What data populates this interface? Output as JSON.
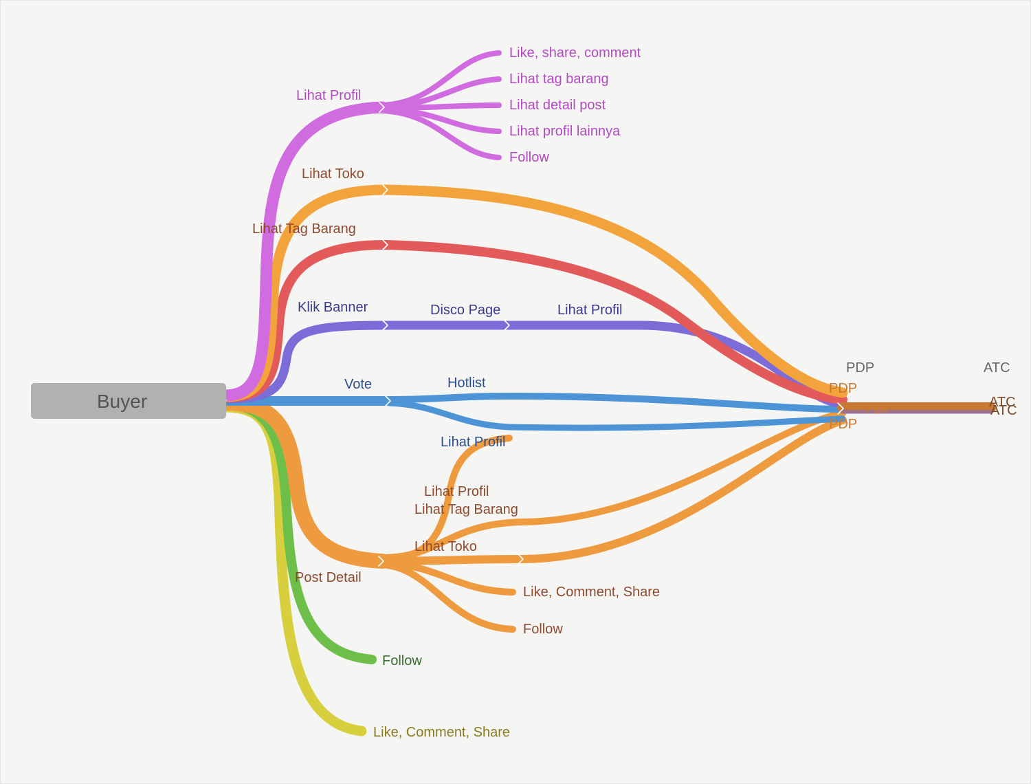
{
  "chart_data": {
    "type": "sankey-style-flow-tree",
    "root": {
      "label": "Buyer"
    },
    "branches": [
      {
        "id": "lihat-profil",
        "label": "Lihat Profil",
        "color": "#d06be0",
        "children": [
          {
            "id": "lp-like",
            "label": "Like, share, comment"
          },
          {
            "id": "lp-tag",
            "label": "Lihat tag barang"
          },
          {
            "id": "lp-det",
            "label": "Lihat detail post"
          },
          {
            "id": "lp-prof",
            "label": "Lihat profil lainnya"
          },
          {
            "id": "lp-fol",
            "label": "Follow"
          }
        ]
      },
      {
        "id": "lihat-toko",
        "label": "Lihat Toko",
        "color": "#f2a33b",
        "to": {
          "id": "pdp",
          "label": "PDP"
        }
      },
      {
        "id": "lihat-tag-barang",
        "label": "Lihat Tag Barang",
        "color": "#e35a5a",
        "to": {
          "id": "pdp",
          "label": "PDP"
        }
      },
      {
        "id": "klik-banner",
        "label": "Klik Banner",
        "color": "#7c6cd8",
        "path": [
          {
            "id": "disco",
            "label": "Disco Page"
          },
          {
            "id": "kb-lp",
            "label": "Lihat Profil"
          }
        ],
        "to": {
          "id": "pdp",
          "label": "PDP"
        }
      },
      {
        "id": "vote",
        "label": "Vote",
        "color": "#4d94d6",
        "paths": [
          [
            {
              "id": "hotlist",
              "label": "Hotlist"
            },
            {
              "id": "pdp",
              "label": "PDP"
            }
          ],
          [
            {
              "id": "vote-lp",
              "label": "Lihat Profil"
            },
            {
              "id": "pdp",
              "label": "PDP"
            }
          ]
        ]
      },
      {
        "id": "post-detail",
        "label": "Post Detail",
        "color": "#ee9a3f",
        "children": [
          {
            "id": "pd-lp",
            "label": "Lihat Profil"
          },
          {
            "id": "pd-tag",
            "label": "Lihat Tag Barang",
            "to": {
              "id": "pdp",
              "label": "PDP"
            }
          },
          {
            "id": "pd-toko",
            "label": "Lihat Toko",
            "to": {
              "id": "pdp",
              "label": "PDP"
            }
          },
          {
            "id": "pd-like",
            "label": "Like, Comment, Share"
          },
          {
            "id": "pd-fol",
            "label": "Follow"
          }
        ]
      },
      {
        "id": "follow",
        "label": "Follow",
        "color": "#6dbf4a"
      },
      {
        "id": "lcs",
        "label": "Like, Comment, Share",
        "color": "#d7cf3d"
      }
    ],
    "sinks": [
      {
        "id": "pdp",
        "label": "PDP",
        "color": "#c77934"
      },
      {
        "id": "atc",
        "label": "ATC",
        "color": "#7a4a2a"
      }
    ],
    "pdp_to_atc": true
  },
  "labels": {
    "root": "Buyer",
    "lihat_profil": "Lihat Profil",
    "lp_like": "Like, share, comment",
    "lp_tag": "Lihat tag barang",
    "lp_det": "Lihat detail post",
    "lp_prof": "Lihat profil lainnya",
    "lp_fol": "Follow",
    "lihat_toko": "Lihat Toko",
    "lihat_tag_barang": "Lihat Tag Barang",
    "klik_banner": "Klik Banner",
    "disco": "Disco Page",
    "kb_lp": "Lihat Profil",
    "vote": "Vote",
    "hotlist": "Hotlist",
    "vote_lp": "Lihat Profil",
    "post_detail": "Post Detail",
    "pd_lp": "Lihat Profil",
    "pd_tag": "Lihat Tag Barang",
    "pd_toko": "Lihat Toko",
    "pd_like": "Like, Comment, Share",
    "pd_fol": "Follow",
    "follow": "Follow",
    "lcs": "Like, Comment, Share",
    "pdp_big": "PDP",
    "atc_big": "ATC",
    "pdp_small": "PDP",
    "atc_small": "ATC"
  },
  "colors": {
    "magenta": "#d06be0",
    "magenta_text": "#b24ac2",
    "orange": "#f2a33b",
    "orange_text": "#c77934",
    "brown_text": "#8e4a2f",
    "red": "#e35a5a",
    "purple": "#7c6cd8",
    "purple_text": "#3a3a8e",
    "blue": "#4d94d6",
    "blue_text": "#2a4e8e",
    "green": "#6dbf4a",
    "green_text": "#3a6e2f",
    "yellow": "#d7cf3d",
    "yellow_text": "#8a7a1f",
    "grey_text": "#666666"
  }
}
